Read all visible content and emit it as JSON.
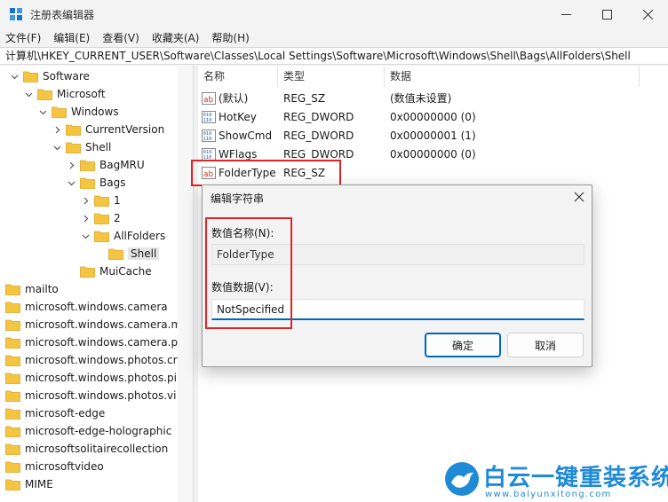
{
  "window": {
    "title": "注册表编辑器"
  },
  "menu": [
    "文件(F)",
    "编辑(E)",
    "查看(V)",
    "收藏夹(A)",
    "帮助(H)"
  ],
  "address": "计算机\\HKEY_CURRENT_USER\\Software\\Classes\\Local Settings\\Software\\Microsoft\\Windows\\Shell\\Bags\\AllFolders\\Shell",
  "tree": [
    {
      "label": "Software",
      "chevron": "down"
    },
    {
      "label": "Microsoft",
      "chevron": "down"
    },
    {
      "label": "Windows",
      "chevron": "down"
    },
    {
      "label": "CurrentVersion",
      "chevron": "right"
    },
    {
      "label": "Shell",
      "chevron": "down"
    },
    {
      "label": "BagMRU",
      "chevron": "right"
    },
    {
      "label": "Bags",
      "chevron": "down"
    },
    {
      "label": "1",
      "chevron": "right"
    },
    {
      "label": "2",
      "chevron": "right"
    },
    {
      "label": "AllFolders",
      "chevron": "down"
    },
    {
      "label": "Shell",
      "chevron": "none",
      "selected": true
    },
    {
      "label": "MuiCache",
      "chevron": "none"
    },
    {
      "label": "mailto",
      "chevron": "none"
    },
    {
      "label": "microsoft.windows.camera",
      "chevron": "none"
    },
    {
      "label": "microsoft.windows.camera.m",
      "chevron": "none"
    },
    {
      "label": "microsoft.windows.camera.pi",
      "chevron": "none"
    },
    {
      "label": "microsoft.windows.photos.cr",
      "chevron": "none"
    },
    {
      "label": "microsoft.windows.photos.pi",
      "chevron": "none"
    },
    {
      "label": "microsoft.windows.photos.vi",
      "chevron": "none"
    },
    {
      "label": "microsoft-edge",
      "chevron": "none"
    },
    {
      "label": "microsoft-edge-holographic",
      "chevron": "none"
    },
    {
      "label": "microsoftsolitairecollection",
      "chevron": "none"
    },
    {
      "label": "microsoftvideo",
      "chevron": "none"
    },
    {
      "label": "MIME",
      "chevron": "none"
    }
  ],
  "columns": {
    "name": "名称",
    "type": "类型",
    "data": "数据"
  },
  "values": [
    {
      "name": "(默认)",
      "type": "REG_SZ",
      "data": "(数值未设置)",
      "icon": "string-value-icon"
    },
    {
      "name": "HotKey",
      "type": "REG_DWORD",
      "data": "0x00000000 (0)",
      "icon": "binary-value-icon"
    },
    {
      "name": "ShowCmd",
      "type": "REG_DWORD",
      "data": "0x00000001 (1)",
      "icon": "binary-value-icon"
    },
    {
      "name": "WFlags",
      "type": "REG_DWORD",
      "data": "0x00000000 (0)",
      "icon": "binary-value-icon"
    },
    {
      "name": "FolderType",
      "type": "REG_SZ",
      "data": "",
      "icon": "string-value-icon"
    }
  ],
  "dialog": {
    "title": "编辑字符串",
    "name_label": "数值名称(N):",
    "name_value": "FolderType",
    "data_label": "数值数据(V):",
    "data_value": "NotSpecified",
    "ok": "确定",
    "cancel": "取消"
  },
  "watermark": {
    "brand": "白云一键重装系统",
    "url": "www.baiyunxitong.com"
  },
  "colors": {
    "accent": "#0067c0",
    "folder": "#f5c542",
    "highlight": "#e02424",
    "brand": "#1f8ad6"
  }
}
